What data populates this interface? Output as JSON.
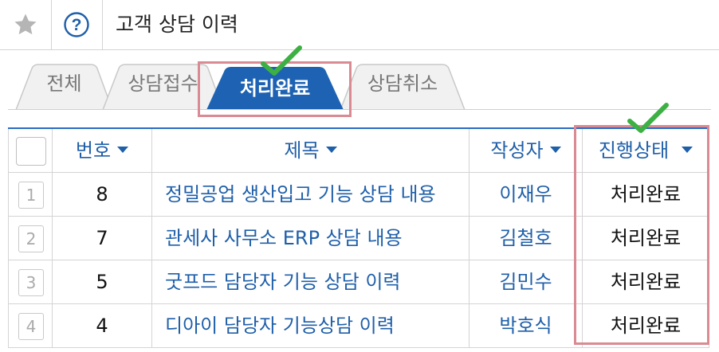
{
  "header": {
    "star_icon": "star-icon",
    "help_icon": "help-circle-icon",
    "title": "고객 상담 이력"
  },
  "tabs": [
    {
      "label": "전체",
      "active": false
    },
    {
      "label": "상담접수",
      "active": false
    },
    {
      "label": "처리완료",
      "active": true
    },
    {
      "label": "상담취소",
      "active": false
    }
  ],
  "table": {
    "columns": [
      "번호",
      "제목",
      "작성자",
      "진행상태"
    ],
    "rows": [
      {
        "index": "1",
        "no": "8",
        "title": "정밀공업 생산입고 기능 상담 내용",
        "author": "이재우",
        "status": "처리완료"
      },
      {
        "index": "2",
        "no": "7",
        "title": "관세사 사무소 ERP 상담 내용",
        "author": "김철호",
        "status": "처리완료"
      },
      {
        "index": "3",
        "no": "5",
        "title": "굿프드 담당자 기능 상담 이력",
        "author": "김민수",
        "status": "처리완료"
      },
      {
        "index": "4",
        "no": "4",
        "title": "디아이 담당자 기능상담 이력",
        "author": "박호식",
        "status": "처리완료"
      }
    ]
  },
  "colors": {
    "accent": "#1f5fa9",
    "active_tab": "#1e63b3",
    "highlight_border": "#d98a92",
    "check_mark": "#3cb043"
  }
}
